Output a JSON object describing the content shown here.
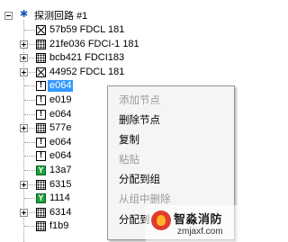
{
  "tree": {
    "root_label": "探测回路 #1",
    "items": [
      {
        "label": "57b59 FDCL 181",
        "icon": "x",
        "expand": ""
      },
      {
        "label": "21fe036 FDCI-1 181",
        "icon": "grid",
        "expand": "plus"
      },
      {
        "label": "bcb421 FDCI183",
        "icon": "grid",
        "expand": "plus"
      },
      {
        "label": "44952 FDCL 181",
        "icon": "x",
        "expand": "plus"
      },
      {
        "label": "e064",
        "icon": "excl",
        "expand": "",
        "selected": true
      },
      {
        "label": "e019",
        "icon": "excl",
        "expand": ""
      },
      {
        "label": "e064",
        "icon": "excl",
        "expand": ""
      },
      {
        "label": "577e",
        "icon": "grid",
        "expand": "plus"
      },
      {
        "label": "e064",
        "icon": "excl",
        "expand": ""
      },
      {
        "label": "e064",
        "icon": "excl",
        "expand": ""
      },
      {
        "label": "13a7",
        "icon": "green",
        "expand": ""
      },
      {
        "label": "6315",
        "icon": "grid",
        "expand": "plus"
      },
      {
        "label": "1114",
        "icon": "green",
        "expand": ""
      },
      {
        "label": "6314",
        "icon": "grid",
        "expand": "plus"
      },
      {
        "label": "f1b9",
        "icon": "grid",
        "expand": ""
      }
    ]
  },
  "context_menu": {
    "items": [
      {
        "label": "添加节点",
        "enabled": false
      },
      {
        "label": "删除节点",
        "enabled": true
      },
      {
        "label": "复制",
        "enabled": true
      },
      {
        "label": "粘贴",
        "enabled": false
      },
      {
        "label": "分配到组",
        "enabled": true
      },
      {
        "label": "从组中删除",
        "enabled": false
      },
      {
        "label": "分配到",
        "enabled": true
      }
    ]
  },
  "watermark": {
    "title": "智淼消防",
    "url": "zmjaxf.com"
  },
  "colors": {
    "selection": "#3399ff",
    "root_icon": "#1c58b8",
    "green_icon": "#1aa33a"
  }
}
